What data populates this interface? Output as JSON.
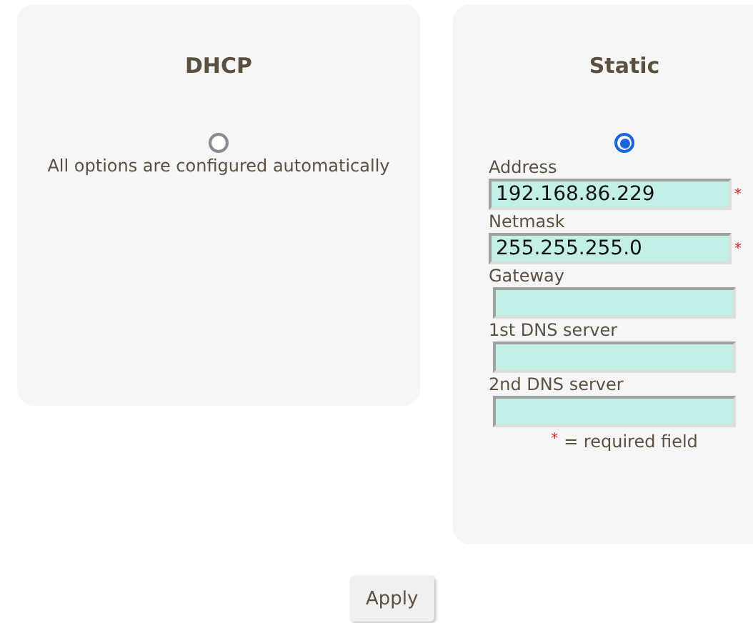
{
  "modes": [
    {
      "kind": "dhcp",
      "title": "DHCP",
      "selected": false,
      "description": "All options are configured automatically"
    },
    {
      "kind": "static",
      "title": "Static",
      "selected": true,
      "fields": [
        {
          "label": "Address",
          "value": "192.168.86.229",
          "required_mark": "*"
        },
        {
          "label": "Netmask",
          "value": "255.255.255.0",
          "required_mark": "*"
        },
        {
          "label": "Gateway"
        },
        {
          "label": "1st DNS server"
        },
        {
          "label": "2nd DNS server"
        }
      ],
      "legend": {
        "mark": "*",
        "text": "= required field"
      }
    }
  ],
  "apply_button": "Apply"
}
